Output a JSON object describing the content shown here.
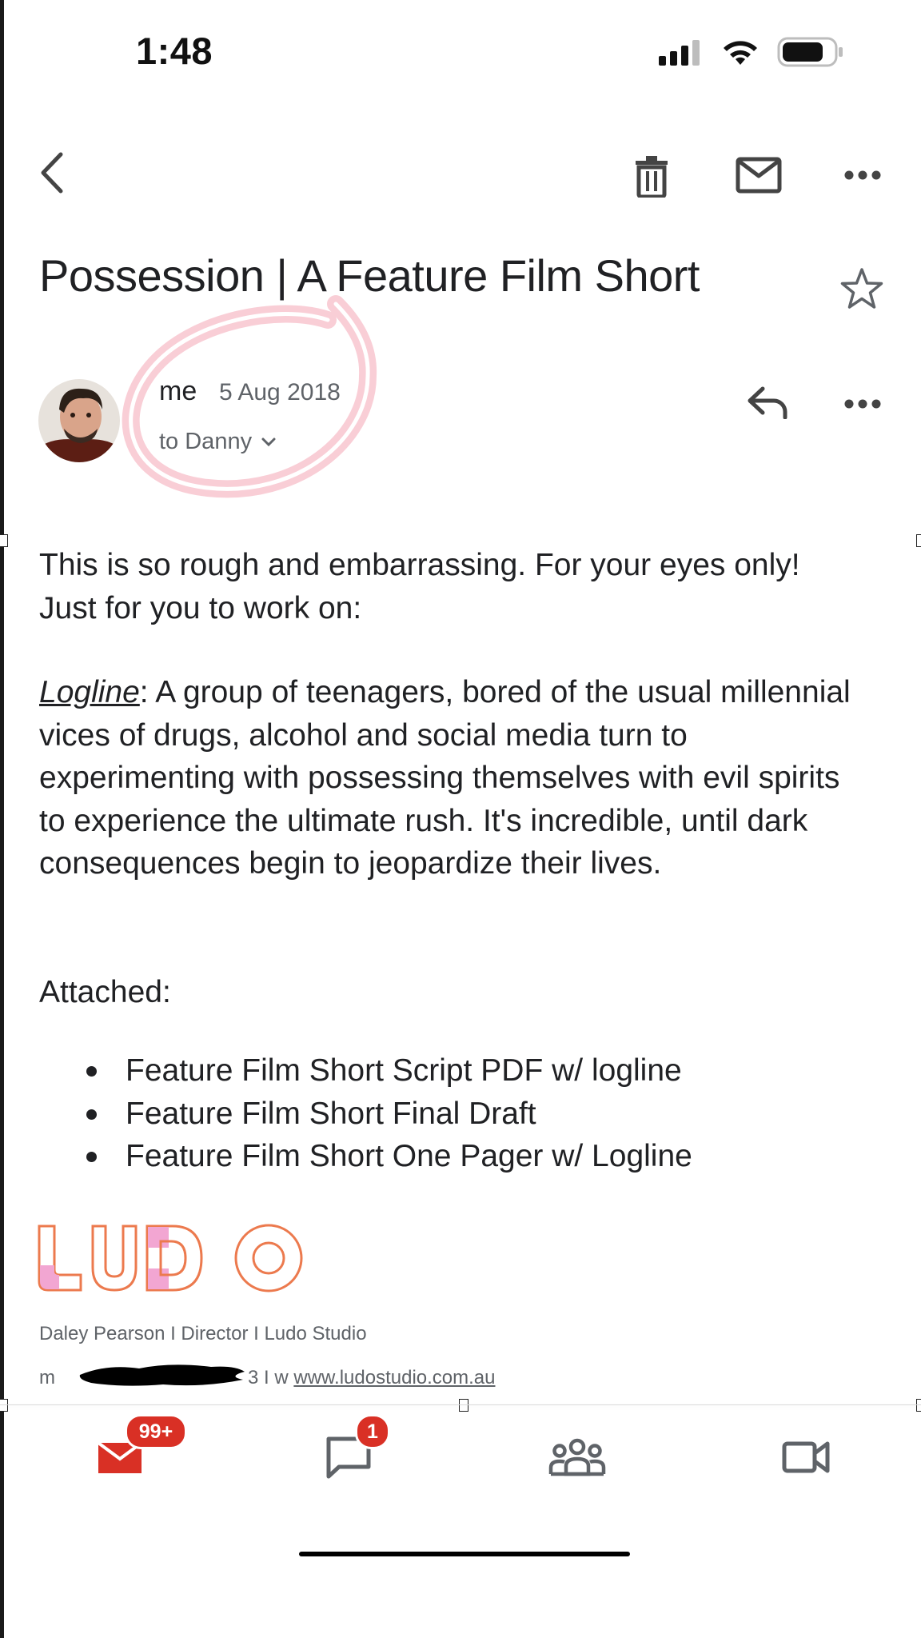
{
  "status_bar": {
    "time": "1:48"
  },
  "email": {
    "subject": "Possession | A Feature Film Short",
    "sender": "me",
    "date": "5 Aug 2018",
    "recipient": "to Danny",
    "body": {
      "p1": "This is so rough and embarrassing. For your eyes only! Just for you to work on:",
      "logline_label": "Logline",
      "logline_text": ": A group of teenagers, bored of the usual millennial vices of drugs, alcohol and social media turn to experimenting with possessing themselves with evil spirits to experience the ultimate rush. It's incredible, until dark consequences begin to jeopardize their lives.",
      "attached_label": "Attached:",
      "attachments": [
        "Feature Film Short Script PDF w/ logline",
        "Feature Film Short Final Draft",
        "Feature Film Short One Pager w/ Logline"
      ]
    },
    "signature": {
      "logo_text": "LUDO",
      "line": "Daley Pearson I Director I Ludo Studio",
      "m_label": "m",
      "redacted_fragment": "3 I w",
      "website": "www.ludostudio.com.au"
    }
  },
  "bottom_nav": {
    "mail_badge": "99+",
    "chat_badge": "1",
    "accent_color": "#d93025"
  },
  "colors": {
    "annotation_glow": "#f4a6b4",
    "logo_orange": "#ec7a4e",
    "logo_pink": "#f2a6d2"
  }
}
